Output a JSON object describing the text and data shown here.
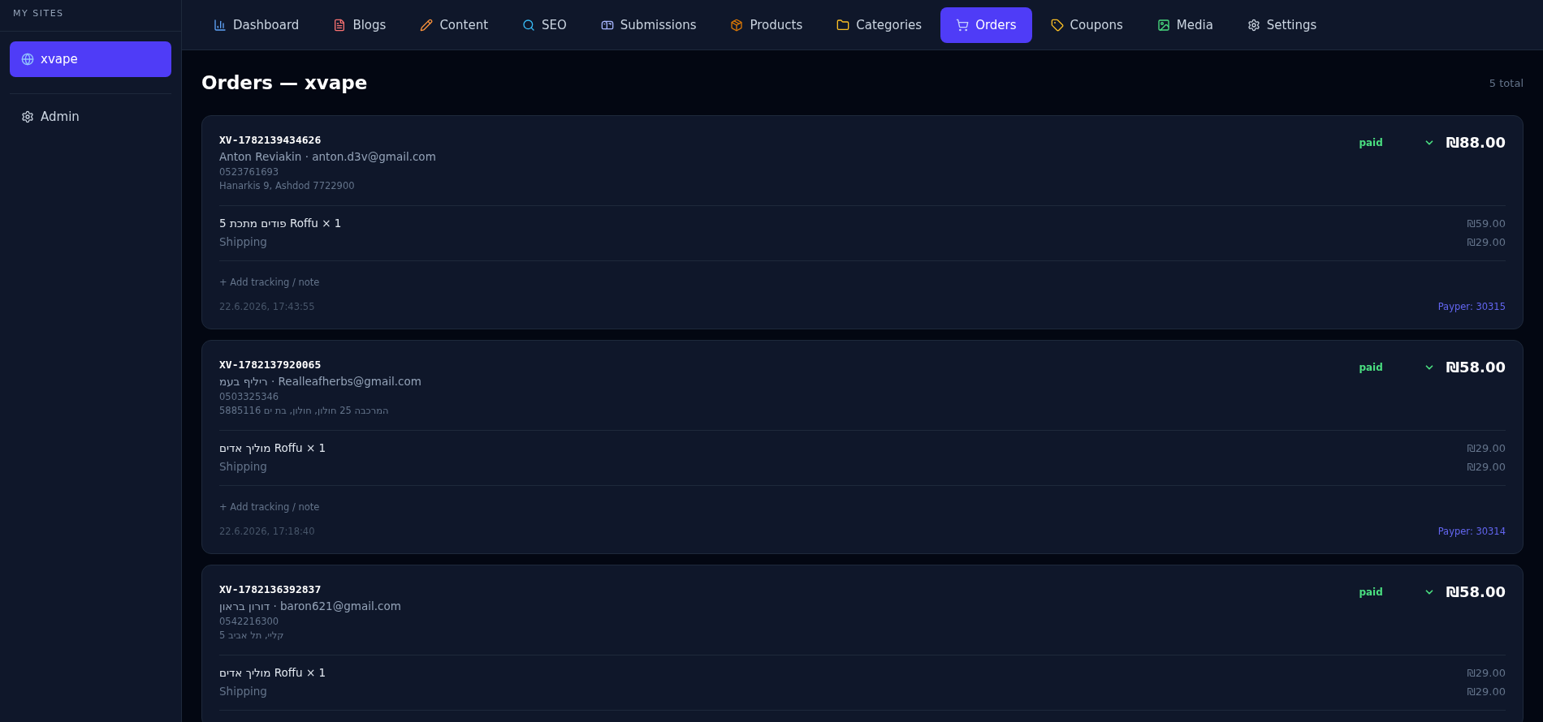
{
  "sidebar": {
    "heading": "MY SITES",
    "sites": [
      {
        "label": "xvape",
        "selected": true
      }
    ],
    "admin": {
      "label": "Admin"
    }
  },
  "nav": {
    "tabs": [
      {
        "label": "Dashboard",
        "kind": "chart",
        "selected": false
      },
      {
        "label": "Blogs",
        "kind": "doc",
        "selected": false
      },
      {
        "label": "Content",
        "kind": "pencil",
        "selected": false
      },
      {
        "label": "SEO",
        "kind": "search",
        "selected": false
      },
      {
        "label": "Submissions",
        "kind": "mailbox",
        "selected": false
      },
      {
        "label": "Products",
        "kind": "package",
        "selected": false
      },
      {
        "label": "Categories",
        "kind": "folder",
        "selected": false
      },
      {
        "label": "Orders",
        "kind": "cart",
        "selected": true
      },
      {
        "label": "Coupons",
        "kind": "tag",
        "selected": false
      },
      {
        "label": "Media",
        "kind": "image",
        "selected": false
      },
      {
        "label": "Settings",
        "kind": "gear",
        "selected": false
      }
    ]
  },
  "page": {
    "title": "Orders — xvape",
    "count": "5 total"
  },
  "orders": [
    {
      "id": "XV-1782139434626",
      "customer": "Anton Reviakin · anton.d3v@gmail.com",
      "phone": "0523761693",
      "address": "Hanarkis 9, Ashdod 7722900",
      "status": "paid",
      "total": "₪88.00",
      "lines": [
        {
          "label": "5 פודים מתכת Roffu × 1",
          "amount": "₪59.00",
          "kind": "item"
        },
        {
          "label": "Shipping",
          "amount": "₪29.00",
          "kind": "shipping"
        }
      ],
      "add_note": "+ Add tracking / note",
      "date": "22.6.2026, 17:43:55",
      "payment": "Payper: 30315"
    },
    {
      "id": "XV-1782137920065",
      "customer": "ריליף בעמ · Realleafherbs@gmail.com",
      "phone": "0503325346",
      "address": "המרכבה 25 חולון, חולון, בת ים 5885116",
      "status": "paid",
      "total": "₪58.00",
      "lines": [
        {
          "label": "מוליך אדים Roffu × 1",
          "amount": "₪29.00",
          "kind": "item"
        },
        {
          "label": "Shipping",
          "amount": "₪29.00",
          "kind": "shipping"
        }
      ],
      "add_note": "+ Add tracking / note",
      "date": "22.6.2026, 17:18:40",
      "payment": "Payper: 30314"
    },
    {
      "id": "XV-1782136392837",
      "customer": "דורון בראון · baron621@gmail.com",
      "phone": "0542216300",
      "address": "קליי, תל אביב 5",
      "status": "paid",
      "total": "₪58.00",
      "lines": [
        {
          "label": "מוליך אדים Roffu × 1",
          "amount": "₪29.00",
          "kind": "item"
        },
        {
          "label": "Shipping",
          "amount": "₪29.00",
          "kind": "shipping"
        }
      ]
    }
  ]
}
